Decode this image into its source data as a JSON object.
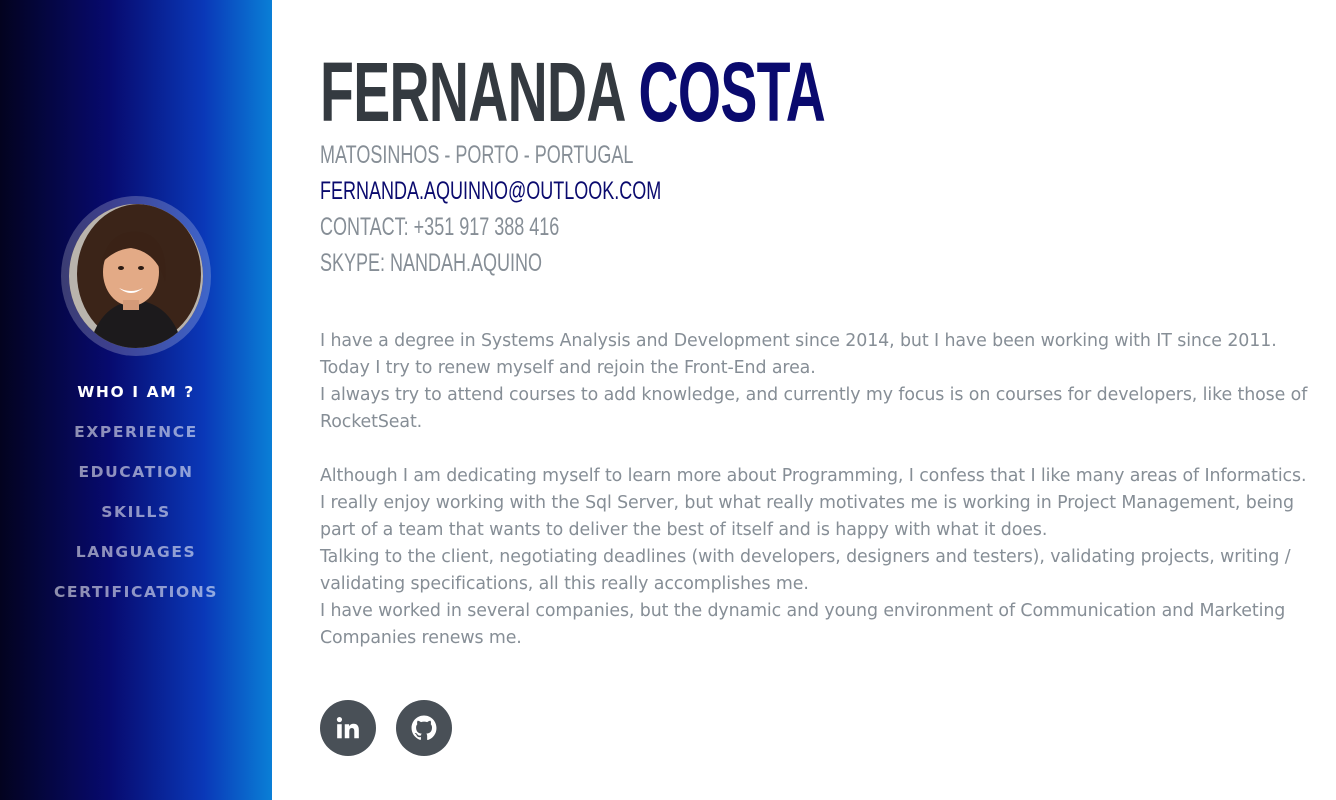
{
  "profile": {
    "first_name": "FERNANDA",
    "last_name": "COSTA",
    "address": "Matosinhos - Porto - Portugal",
    "email": "fernanda.aquinno@outlook.com",
    "contact": "Contact: +351 917 388 416",
    "skype": "Skype: nandah.aquino"
  },
  "nav": {
    "items": [
      {
        "label": "WHO I AM ?",
        "active": true
      },
      {
        "label": "EXPERIENCE",
        "active": false
      },
      {
        "label": "EDUCATION",
        "active": false
      },
      {
        "label": "SKILLS",
        "active": false
      },
      {
        "label": "LANGUAGES",
        "active": false
      },
      {
        "label": "CERTIFICATIONS",
        "active": false
      }
    ]
  },
  "about": {
    "p1": "I have a degree in Systems Analysis and Development since 2014, but I have been working with IT since 2011.",
    "p2": "Today I try to renew myself and rejoin the Front-End area.",
    "p3": "I always try to attend courses to add knowledge, and currently my focus is on courses for developers, like those of RocketSeat.",
    "p4": "Although I am dedicating myself to learn more about Programming, I confess that I like many areas of Informatics.",
    "p5": "I really enjoy working with the Sql Server, but what really motivates me is working in Project Management, being part of a team that wants to deliver the best of itself and is happy with what it does.",
    "p6": "Talking to the client, negotiating deadlines (with developers, designers and testers), validating projects, writing / validating specifications, all this really accomplishes me.",
    "p7": "I have worked in several companies, but the dynamic and young environment of Communication and Marketing Companies renews me."
  },
  "social": {
    "linkedin_icon": "linkedin-icon",
    "github_icon": "github-icon"
  },
  "colors": {
    "accent": "#0a0a6e",
    "name_dark": "#343a40",
    "muted_text": "#868e96",
    "social_bg": "#495057"
  }
}
